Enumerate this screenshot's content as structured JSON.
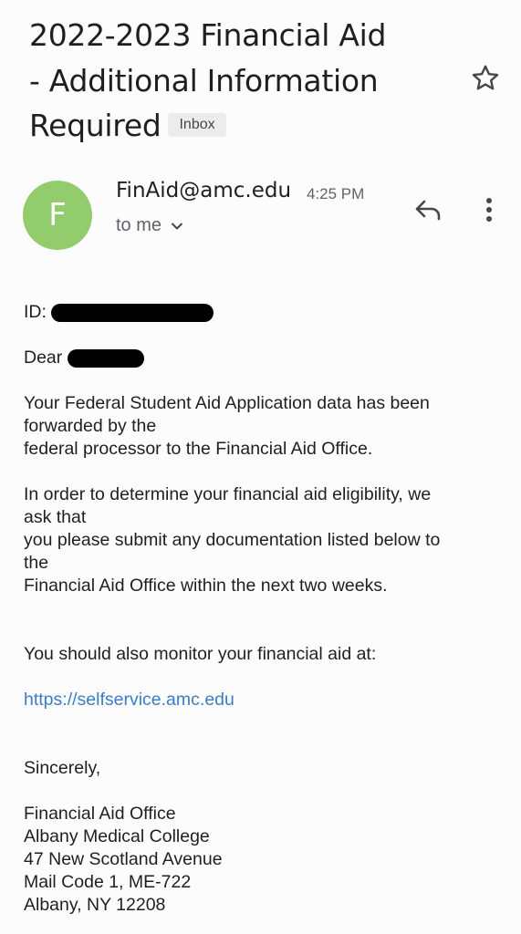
{
  "email": {
    "subject_lines": [
      "2022-2023  Financial Aid",
      "- Additional Information",
      "Required"
    ],
    "label_chip": "Inbox",
    "avatar_letter": "F",
    "sender": "FinAid@amc.edu",
    "time": "4:25 PM",
    "recipient": "to me"
  },
  "icons": {
    "star": "star-icon",
    "reply": "reply-icon",
    "more": "more-vert-icon",
    "expand": "chevron-down-icon"
  },
  "colors": {
    "avatar_bg": "#93cc6c",
    "link": "#3a7dc4",
    "chip_bg": "#ececec"
  },
  "body": {
    "id_label": "ID:",
    "dear_label": "Dear",
    "para1": [
      "Your Federal Student Aid Application data has been",
      "forwarded by the",
      "federal processor to the Financial Aid Office."
    ],
    "para2": [
      "In order to determine your financial aid eligibility, we",
      "ask that",
      "you please submit any documentation listed below to",
      "the",
      "Financial Aid Office within the next two weeks."
    ],
    "monitor": "You should also monitor your financial aid at:",
    "link": "https://selfservice.amc.edu",
    "closing": "Sincerely,",
    "signature": [
      "Financial Aid Office",
      "Albany Medical College",
      "47 New Scotland Avenue",
      "Mail Code 1, ME-722",
      "Albany, NY  12208"
    ]
  }
}
